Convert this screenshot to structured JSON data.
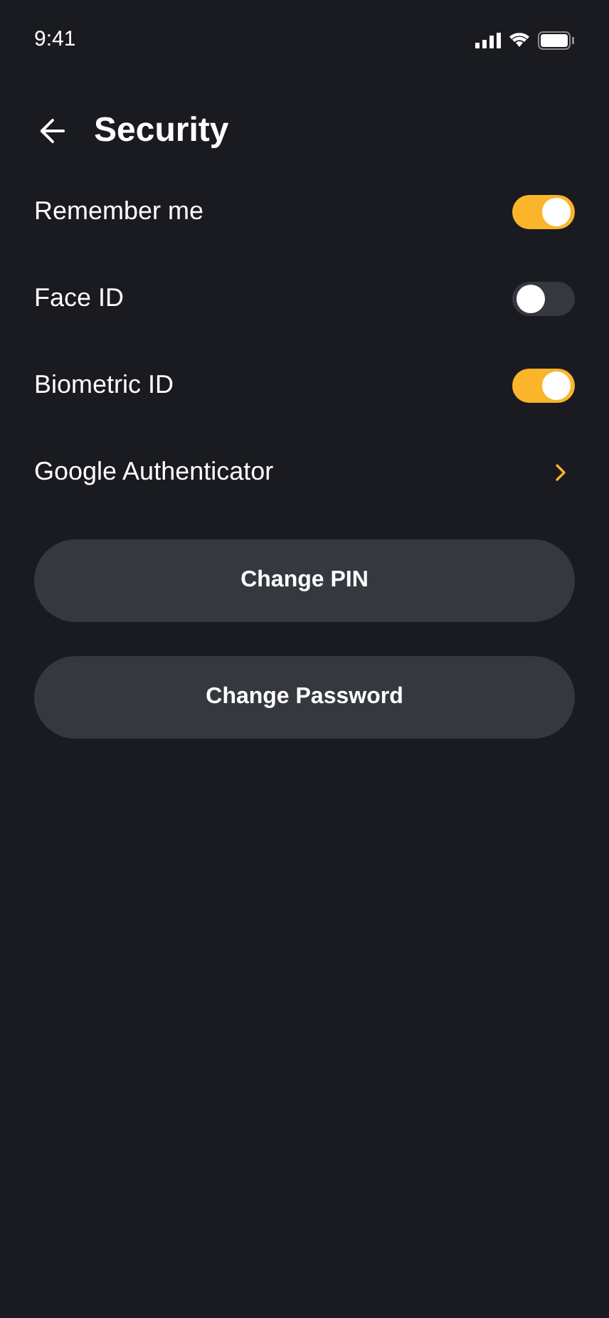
{
  "status_bar": {
    "time": "9:41"
  },
  "header": {
    "title": "Security"
  },
  "settings": [
    {
      "kind": "toggle",
      "label": "Remember me",
      "on": true
    },
    {
      "kind": "toggle",
      "label": "Face ID",
      "on": false
    },
    {
      "kind": "toggle",
      "label": "Biometric ID",
      "on": true
    },
    {
      "kind": "link",
      "label": "Google Authenticator"
    }
  ],
  "buttons": [
    "Change PIN",
    "Change Password"
  ]
}
